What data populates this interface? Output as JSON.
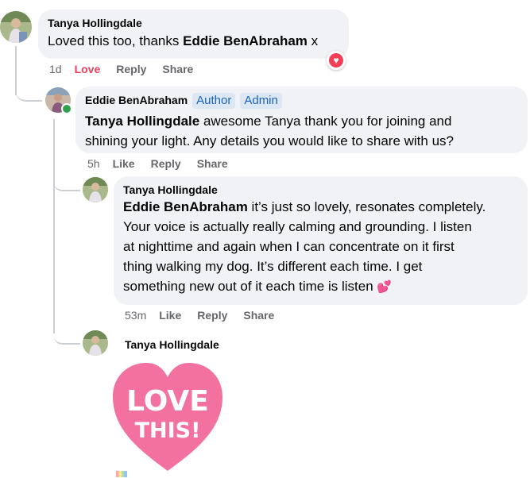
{
  "comments": [
    {
      "author": "Tanya Hollingdale",
      "text_before": "Loved this too, thanks ",
      "mention": "Eddie BenAbraham",
      "text_after": " x",
      "time": "1d",
      "actions": {
        "love": "Love",
        "reply": "Reply",
        "share": "Share"
      },
      "reaction_icon": "heart-icon"
    },
    {
      "author": "Eddie BenAbraham",
      "badges": [
        "Author",
        "Admin"
      ],
      "mention": "Tanya Hollingdale",
      "text_line1": " awesome Tanya thank you for joining and",
      "text_line2": "shining your light. Any details you would like to share with us?",
      "time": "5h",
      "actions": {
        "like": "Like",
        "reply": "Reply",
        "share": "Share"
      }
    },
    {
      "author": "Tanya Hollingdale",
      "mention": "Eddie BenAbraham",
      "text_line1": " it’s just so lovely, resonates completely.",
      "text_line2": "Your voice is actually really calming and grounding. I listen",
      "text_line3": "at nighttime and again when I can concentrate on it first",
      "text_line4": "thing walking my dog. It’s different each time. I get",
      "text_line5": "something new out of it each time is listen ",
      "emoji": "💕",
      "time": "53m",
      "actions": {
        "like": "Like",
        "reply": "Reply",
        "share": "Share"
      }
    },
    {
      "author": "Tanya Hollingdale",
      "sticker": {
        "line1": "LOVE",
        "line2": "THIS!",
        "color": "#f2719f"
      }
    }
  ],
  "colors": {
    "love": "#f33e58",
    "badge_bg": "#dbe7f2",
    "badge_text": "#1d63b5",
    "bubble": "#f0f2f5"
  }
}
